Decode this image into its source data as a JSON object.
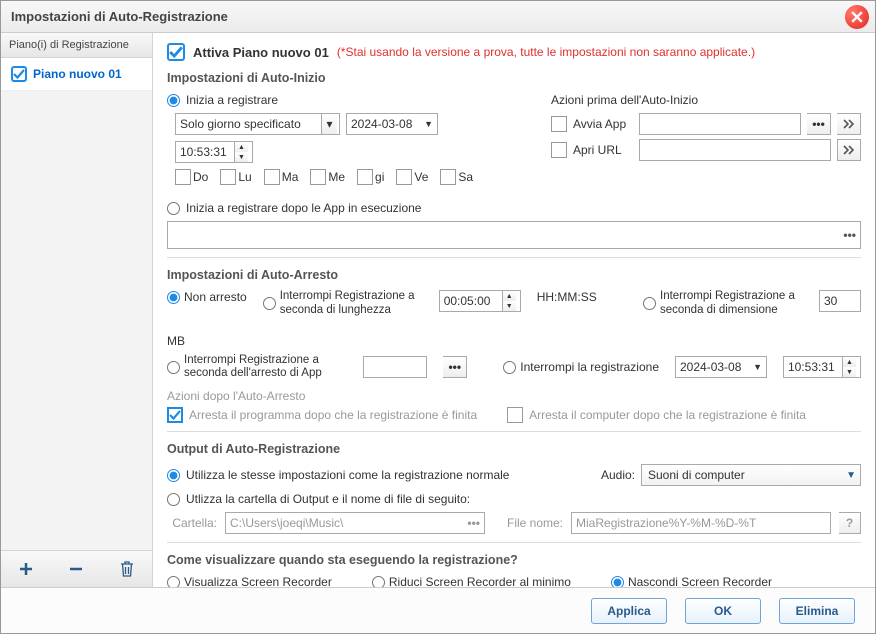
{
  "window": {
    "title": "Impostazioni di Auto-Registrazione"
  },
  "sidebar": {
    "header": "Piano(i) di Registrazione",
    "plan": "Piano nuovo 01"
  },
  "activate": {
    "label": "Attiva Piano nuovo 01",
    "trial": "(*Stai usando la versione a prova, tutte le impostazioni non saranno applicate.)"
  },
  "autoStart": {
    "title": "Impostazioni di Auto-Inizio",
    "startRecording": "Inizia a registrare",
    "scheduleMode": "Solo giorno specificato",
    "date": "2024-03-08",
    "time": "10:53:31",
    "days": {
      "d0": "Do",
      "d1": "Lu",
      "d2": "Ma",
      "d3": "Me",
      "d4": "gi",
      "d5": "Ve",
      "d6": "Sa"
    },
    "startAfterApps": "Inizia a registrare dopo le App in esecuzione",
    "actionsTitle": "Azioni prima dell'Auto-Inizio",
    "launchApp": "Avvia App",
    "openUrl": "Apri URL"
  },
  "autoStop": {
    "title": "Impostazioni di Auto-Arresto",
    "noStop": "Non arresto",
    "stopByLength": "Interrompi Registrazione a seconda di lunghezza",
    "lengthValue": "00:05:00",
    "lengthUnit": "HH:MM:SS",
    "stopBySize": "Interrompi Registrazione a seconda di dimensione",
    "sizeValue": "30",
    "sizeUnit": "MB",
    "stopByAppStop": "Interrompi Registrazione a seconda dell'arresto di App",
    "stopAt": "Interrompi la registrazione",
    "stopDate": "2024-03-08",
    "stopTime": "10:53:31",
    "afterTitle": "Azioni dopo l'Auto-Arresto",
    "exitAfter": "Arresta il programma dopo che la registrazione è finita",
    "shutdownAfter": "Arresta il computer dopo che la registrazione è finita"
  },
  "output": {
    "title": "Output di Auto-Registrazione",
    "sameSettings": "Utilizza le stesse impostazioni come la registrazione normale",
    "customFolder": "Utlizza la cartella di Output e il nome di file di seguito:",
    "folderLabel": "Cartella:",
    "folderValue": "C:\\Users\\joeqi\\Music\\",
    "fileLabel": "File nome:",
    "fileValue": "MiaRegistrazione%Y-%M-%D-%T",
    "audioLabel": "Audio:",
    "audioValue": "Suoni di computer"
  },
  "display": {
    "title": "Come visualizzare quando sta eseguendo la registrazione?",
    "show": "Visualizza Screen Recorder",
    "min": "Riduci Screen Recorder al minimo",
    "hide": "Nascondi Screen Recorder"
  },
  "buttons": {
    "apply": "Applica",
    "ok": "OK",
    "delete": "Elimina"
  }
}
